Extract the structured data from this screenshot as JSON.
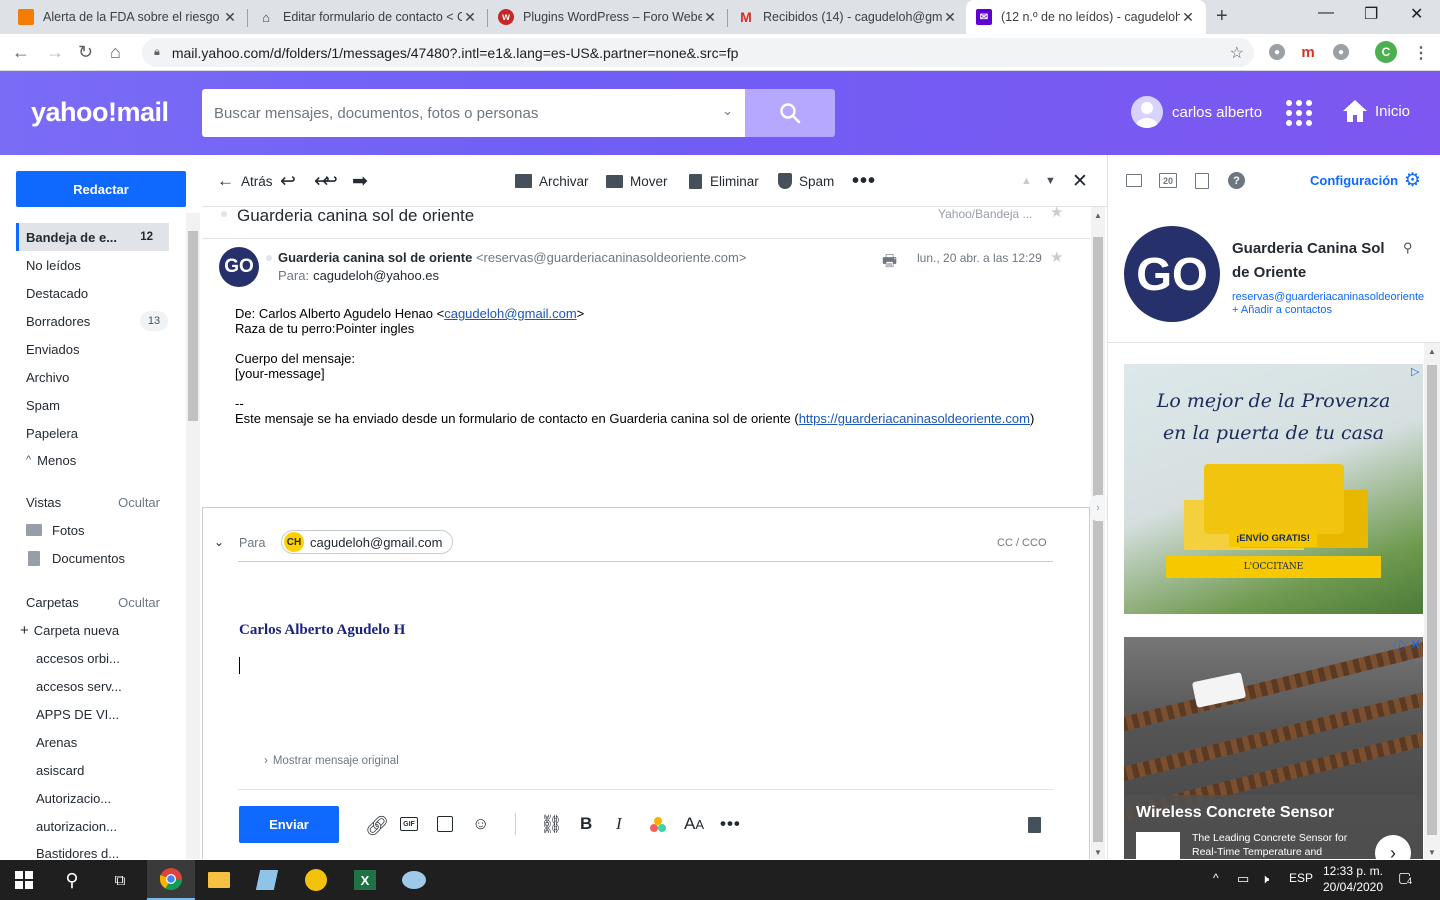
{
  "browser": {
    "tabs": [
      {
        "title": "Alerta de la FDA sobre el riesgo d",
        "icon": "orange-square-icon"
      },
      {
        "title": "Editar formulario de contacto < C",
        "icon": "house-icon"
      },
      {
        "title": "Plugins WordPress – Foro Weber",
        "icon": "red-w-icon"
      },
      {
        "title": "Recibidos (14) - cagudeloh@gma",
        "icon": "gmail-icon"
      },
      {
        "title": "(12 n.º de no leídos) - cagudeloh",
        "icon": "yahoo-mail-icon"
      }
    ],
    "url": "mail.yahoo.com/d/folders/1/messages/47480?.intl=e1&.lang=es-US&.partner=none&.src=fp",
    "profile_initial": "C"
  },
  "header": {
    "logo": "yahoo!mail",
    "search_placeholder": "Buscar mensajes, documentos, fotos o personas",
    "user_name": "carlos alberto",
    "home_label": "Inicio",
    "accent_color": "#6f5ef5"
  },
  "sidebar": {
    "compose_label": "Redactar",
    "folders": [
      {
        "label": "Bandeja de e...",
        "count": "12"
      },
      {
        "label": "No leídos"
      },
      {
        "label": "Destacado"
      },
      {
        "label": "Borradores",
        "count": "13"
      },
      {
        "label": "Enviados"
      },
      {
        "label": "Archivo"
      },
      {
        "label": "Spam"
      },
      {
        "label": "Papelera"
      }
    ],
    "less_label": "Menos",
    "views_label": "Vistas",
    "views_hide": "Ocultar",
    "views": [
      {
        "label": "Fotos",
        "icon": "photo-icon"
      },
      {
        "label": "Documentos",
        "icon": "document-icon"
      }
    ],
    "folders_label": "Carpetas",
    "folders_hide": "Ocultar",
    "new_folder": "Carpeta nueva",
    "user_folders": [
      "accesos orbi...",
      "accesos serv...",
      "APPS DE VI...",
      "Arenas",
      "asiscard",
      "Autorizacio...",
      "autorizacion...",
      "Bastidores d..."
    ]
  },
  "toolbar": {
    "back": "Atrás",
    "archive": "Archivar",
    "move": "Mover",
    "delete": "Eliminar",
    "spam": "Spam"
  },
  "message": {
    "subject": "Guarderia canina sol de oriente",
    "folder_path": "Yahoo/Bandeja ...",
    "sender_initials": "GO",
    "sender_name": "Guarderia canina sol de oriente",
    "sender_email": "<reservas@guarderiacaninasoldeoriente.com>",
    "to_label": "Para:",
    "to": "cagudeloh@yahoo.es",
    "date": "lun., 20 abr. a las 12:29",
    "body": {
      "from_prefix": "De: Carlos Alberto Agudelo Henao <",
      "from_link": "cagudeloh@gmail.com",
      "from_suffix": ">",
      "breed": "Raza de tu perro:Pointer ingles",
      "body_label": "Cuerpo del mensaje:",
      "placeholder": "[your-message]",
      "dashes": "--",
      "footer_prefix": "Este mensaje se ha enviado desde un formulario de contacto en Guarderia canina sol de oriente (",
      "footer_link": "https://guarderiacaninasoldeoriente.com",
      "footer_suffix": ")"
    }
  },
  "composer": {
    "to_label": "Para",
    "recipient_initials": "CH",
    "recipient": "cagudeloh@gmail.com",
    "cc_label": "CC / CCO",
    "signature": "Carlos Alberto Agudelo H",
    "show_original": "Mostrar mensaje original",
    "send_label": "Enviar"
  },
  "rail": {
    "settings_label": "Configuración",
    "calendar_day": "20",
    "contact_initials": "GO",
    "contact_name": "Guarderia Canina Sol de Oriente",
    "contact_email": "reservas@guarderiacaninasoldeoriente.com",
    "add_contact": "+ Añadir a contactos",
    "ad1": {
      "line1": "Lo mejor de la Provenza",
      "line2": "en la puerta de tu casa",
      "ribbon": "¡ENVÍO GRATIS!",
      "brand": "L'OCCITANE"
    },
    "ad2": {
      "title": "Wireless Concrete Sensor",
      "subtitle": "The Leading Concrete Sensor for Real-Time Temperature and"
    }
  },
  "taskbar": {
    "lang": "ESP",
    "time": "12:33 p. m.",
    "date": "20/04/2020",
    "notifications": "4"
  }
}
